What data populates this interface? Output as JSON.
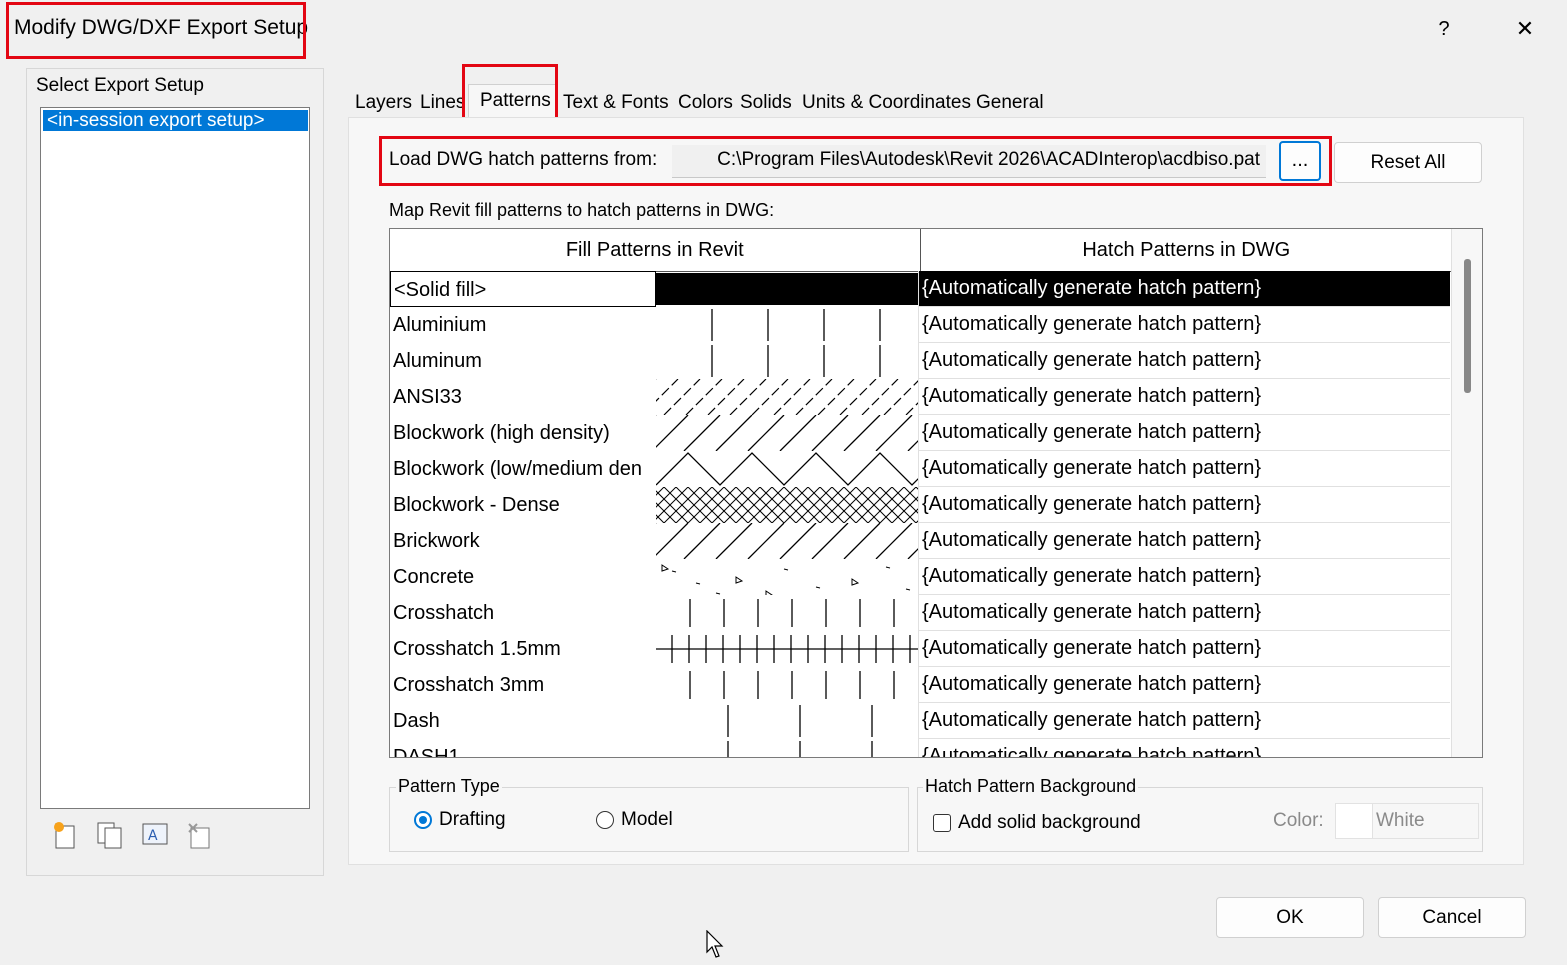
{
  "window": {
    "title": "Modify DWG/DXF Export Setup",
    "help_label": "?",
    "close_label": "✕"
  },
  "setups": {
    "label": "Select Export Setup",
    "items": [
      "<in-session export setup>"
    ]
  },
  "tabs": [
    "Layers",
    "Lines",
    "Patterns",
    "Text & Fonts",
    "Colors",
    "Solids",
    "Units & Coordinates",
    "General"
  ],
  "active_tab": "Patterns",
  "load": {
    "label": "Load DWG hatch patterns from:",
    "path": "C:\\Program Files\\Autodesk\\Revit 2026\\ACADInterop\\acdbiso.pat",
    "browse_label": "...",
    "reset_label": "Reset All"
  },
  "map_label": "Map Revit fill patterns to hatch patterns in DWG:",
  "table": {
    "columns": [
      "Fill Patterns in Revit",
      "Hatch Patterns in DWG"
    ],
    "rows": [
      {
        "name": "<Solid fill>",
        "hatch": "{Automatically generate hatch pattern}",
        "pattern": "solid"
      },
      {
        "name": "Aluminium",
        "hatch": "{Automatically generate hatch pattern}",
        "pattern": "vlines-wide"
      },
      {
        "name": "Aluminum",
        "hatch": "{Automatically generate hatch pattern}",
        "pattern": "vlines-wide"
      },
      {
        "name": "ANSI33",
        "hatch": "{Automatically generate hatch pattern}",
        "pattern": "diag-dashed"
      },
      {
        "name": "Blockwork (high density)",
        "hatch": "{Automatically generate hatch pattern}",
        "pattern": "diag"
      },
      {
        "name": "Blockwork (low/medium den",
        "hatch": "{Automatically generate hatch pattern}",
        "pattern": "zigzag"
      },
      {
        "name": "Blockwork - Dense",
        "hatch": "{Automatically generate hatch pattern}",
        "pattern": "crosshatch-diag"
      },
      {
        "name": "Brickwork",
        "hatch": "{Automatically generate hatch pattern}",
        "pattern": "diag"
      },
      {
        "name": "Concrete",
        "hatch": "{Automatically generate hatch pattern}",
        "pattern": "concrete"
      },
      {
        "name": "Crosshatch",
        "hatch": "{Automatically generate hatch pattern}",
        "pattern": "vlines"
      },
      {
        "name": "Crosshatch 1.5mm",
        "hatch": "{Automatically generate hatch pattern}",
        "pattern": "grid"
      },
      {
        "name": "Crosshatch 3mm",
        "hatch": "{Automatically generate hatch pattern}",
        "pattern": "vlines"
      },
      {
        "name": "Dash",
        "hatch": "{Automatically generate hatch pattern}",
        "pattern": "vlines-sparse"
      },
      {
        "name": "DASH1",
        "hatch": "{Automatically generate hatch pattern}",
        "pattern": "vlines-sparse"
      }
    ],
    "selected_index": 0
  },
  "pattern_type": {
    "title": "Pattern Type",
    "options": [
      "Drafting",
      "Model"
    ],
    "selected": "Drafting"
  },
  "background": {
    "title": "Hatch Pattern Background",
    "checkbox_label": "Add solid background",
    "checked": false,
    "color_label": "Color:",
    "color_value": "White"
  },
  "footer": {
    "ok_label": "OK",
    "cancel_label": "Cancel"
  },
  "colors": {
    "selection": "#0078d7",
    "highlight": "#e30613"
  }
}
